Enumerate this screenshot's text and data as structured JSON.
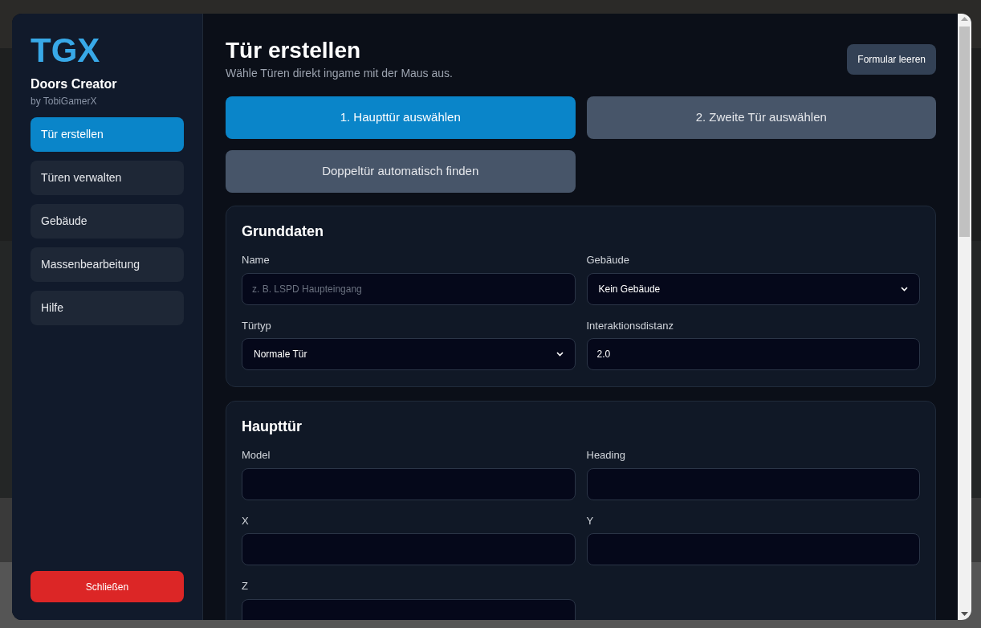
{
  "sidebar": {
    "logo": "TGX",
    "app_name": "Doors Creator",
    "author": "by TobiGamerX",
    "items": [
      {
        "label": "Tür erstellen",
        "selected": true
      },
      {
        "label": "Türen verwalten",
        "selected": false
      },
      {
        "label": "Gebäude",
        "selected": false
      },
      {
        "label": "Massenbearbeitung",
        "selected": false
      },
      {
        "label": "Hilfe",
        "selected": false
      }
    ],
    "close_button": "Schließen"
  },
  "header": {
    "title": "Tür erstellen",
    "subtitle": "Wähle Türen direkt ingame mit der Maus aus.",
    "clear_button": "Formular leeren"
  },
  "actions": [
    {
      "label": "1. Haupttür auswählen",
      "selected": true
    },
    {
      "label": "2. Zweite Tür auswählen",
      "selected": false
    },
    {
      "label": "Doppeltür automatisch finden",
      "selected": false
    }
  ],
  "sections": [
    {
      "title": "Grunddaten",
      "fields": [
        {
          "label": "Name",
          "kind": "input",
          "placeholder": "z. B. LSPD Haupteingang"
        },
        {
          "label": "Gebäude",
          "kind": "select",
          "value": "Kein Gebäude"
        },
        {
          "label": "Türtyp",
          "kind": "select",
          "value": "Normale Tür"
        },
        {
          "label": "Interaktionsdistanz",
          "kind": "input",
          "value": "2.0"
        }
      ]
    },
    {
      "title": "Haupttür",
      "fields": [
        {
          "label": "Model",
          "kind": "input"
        },
        {
          "label": "Heading",
          "kind": "input"
        },
        {
          "label": "X",
          "kind": "input"
        },
        {
          "label": "Y",
          "kind": "input"
        },
        {
          "label": "Z",
          "kind": "input"
        }
      ]
    }
  ]
}
